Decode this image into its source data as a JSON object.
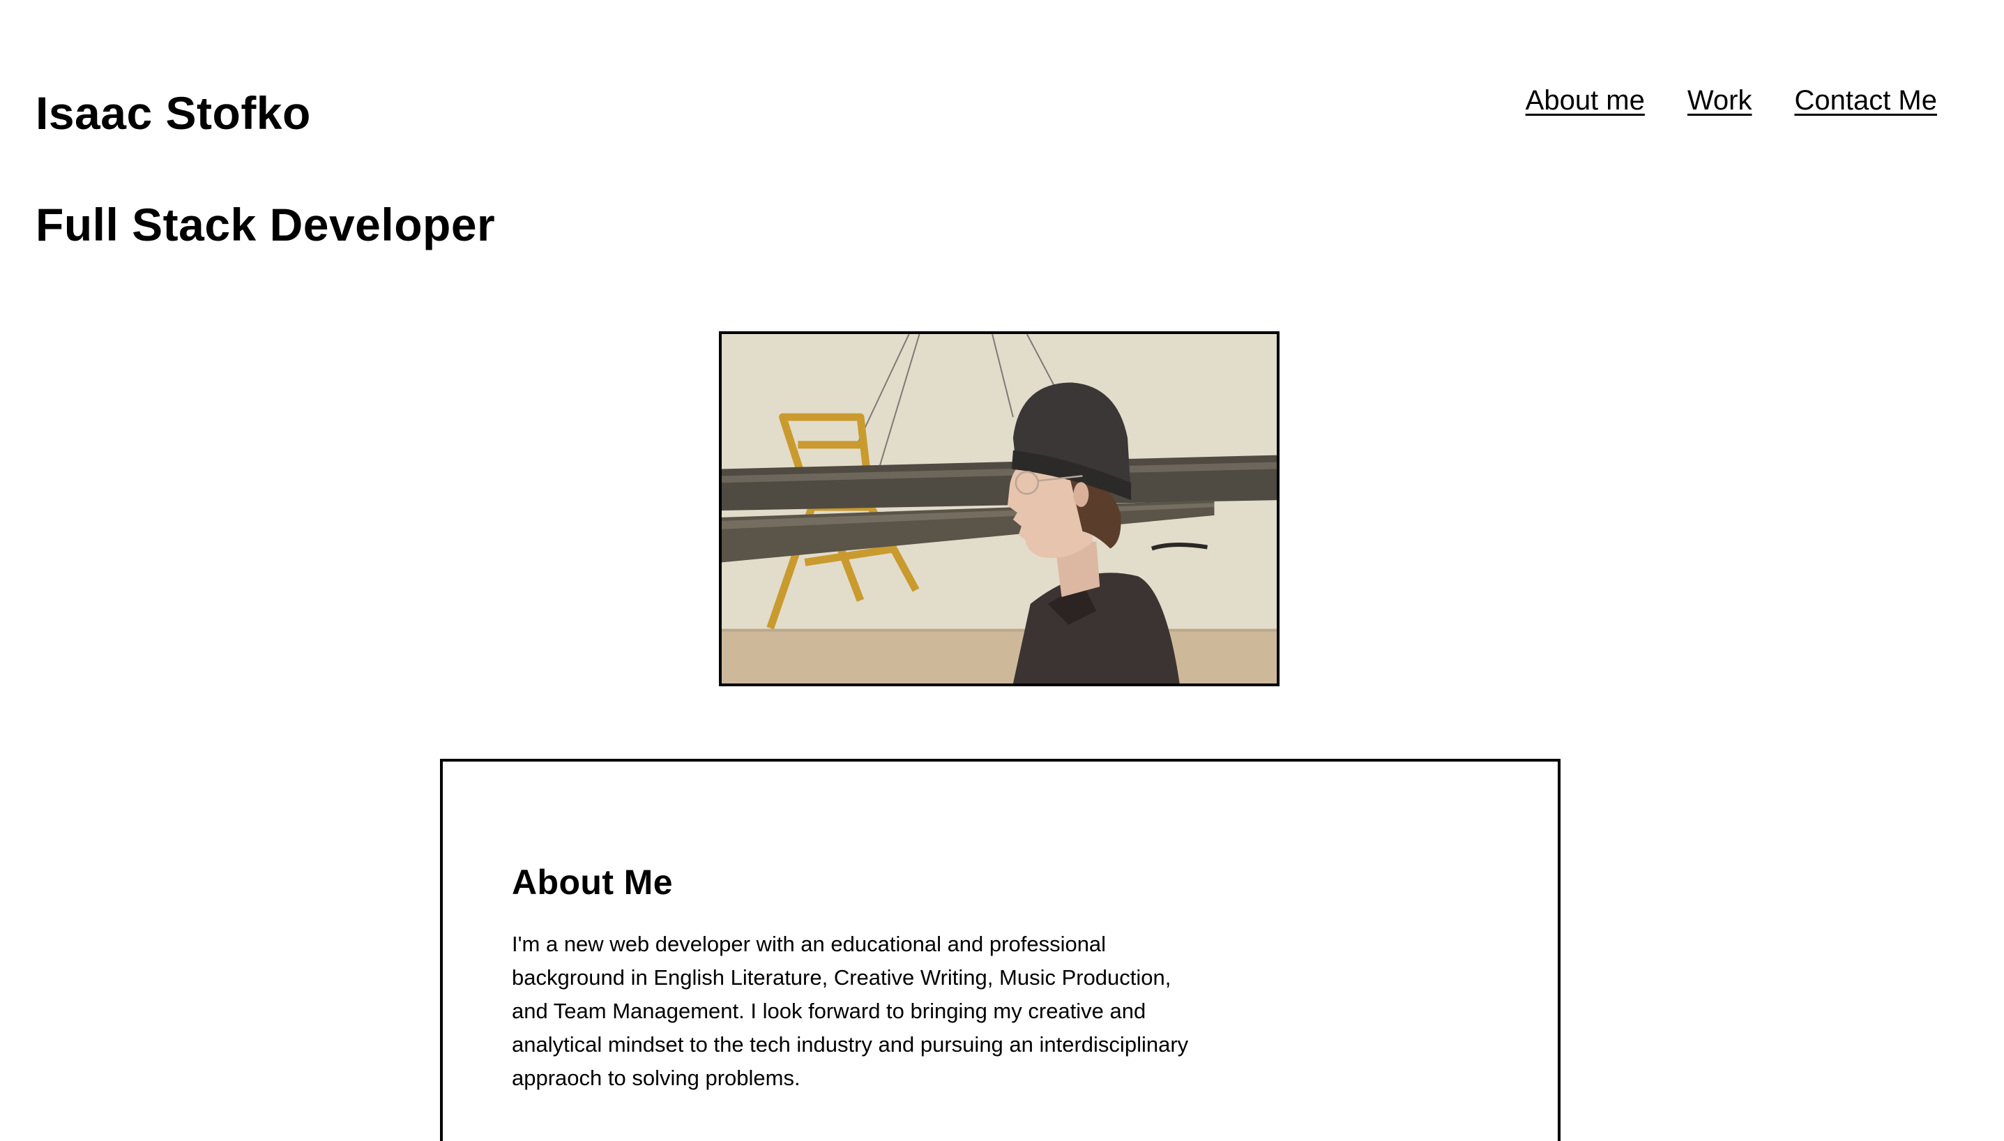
{
  "header": {
    "site_name": "Isaac Stofko",
    "tagline": "Full Stack Developer"
  },
  "nav": {
    "items": [
      {
        "label": "About me"
      },
      {
        "label": "Work"
      },
      {
        "label": "Contact Me"
      }
    ]
  },
  "hero": {
    "image_subject": "profile-photo"
  },
  "about": {
    "title": "About Me",
    "body": "I'm a new web developer with an educational and professional background in English Literature, Creative Writing, Music Production, and Team Management. I look forward to bringing my creative and analytical mindset to the tech industry and pursuing an interdisciplinary appraoch to solving problems."
  },
  "colors": {
    "background": "#ffffff",
    "text": "#000000",
    "border": "#000000"
  }
}
